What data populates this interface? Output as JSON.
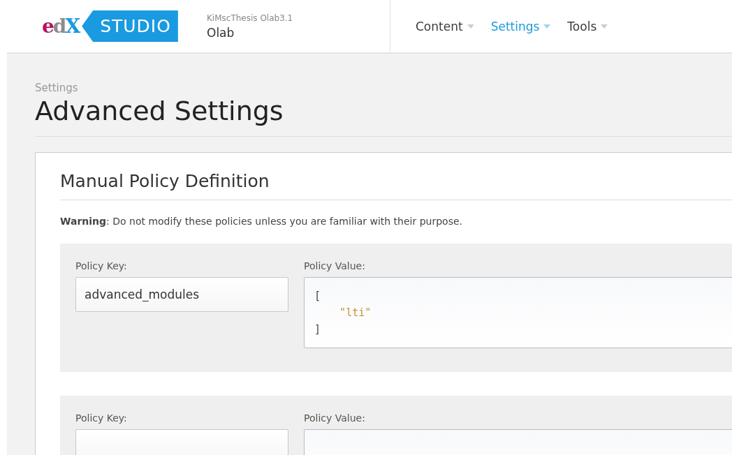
{
  "header": {
    "logo": "edX",
    "product": "STUDIO",
    "course_org": "KiMscThesis",
    "course_number": "Olab3.1",
    "course_name": "Olab",
    "nav": [
      {
        "label": "Content",
        "selected": false
      },
      {
        "label": "Settings",
        "selected": true
      },
      {
        "label": "Tools",
        "selected": false
      }
    ]
  },
  "breadcrumb": "Settings",
  "title": "Advanced Settings",
  "card": {
    "title": "Manual Policy Definition",
    "warning": "**Warning**: Do not modify these policies unless you are familiar with their purpose.",
    "policies": [
      {
        "key_label": "Policy Key:",
        "key": "advanced_modules",
        "value_label": "Policy Value:",
        "value_lines": [
          {
            "kind": "punct",
            "text": "["
          },
          {
            "kind": "string",
            "text": "    \"lti\""
          },
          {
            "kind": "punct",
            "text": "]"
          }
        ]
      },
      {
        "key_label": "Policy Key:",
        "value_label": "Policy Value:"
      }
    ]
  }
}
